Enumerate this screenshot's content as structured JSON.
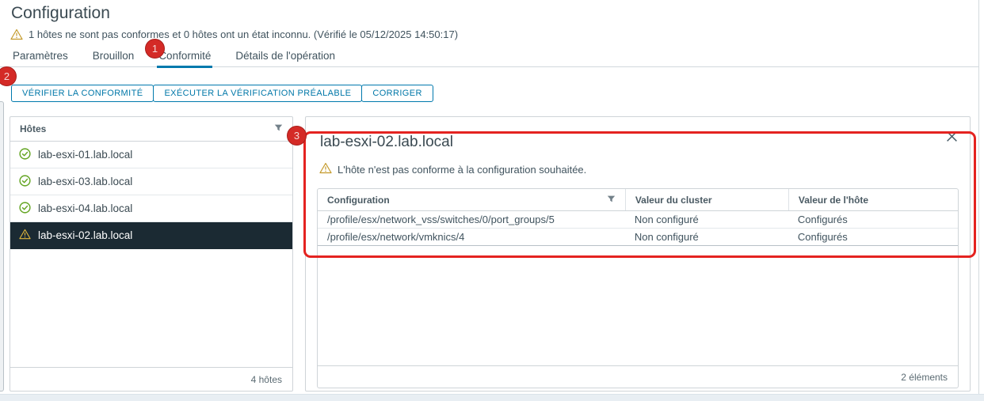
{
  "page": {
    "title": "Configuration",
    "status_message": "1 hôtes ne sont pas conformes et 0 hôtes ont un état inconnu. (Vérifié le 05/12/2025 14:50:17)"
  },
  "tabs": [
    {
      "label": "Paramètres",
      "active": false
    },
    {
      "label": "Brouillon",
      "active": false
    },
    {
      "label": "Conformité",
      "active": true
    },
    {
      "label": "Détails de l'opération",
      "active": false
    }
  ],
  "toolbar": {
    "buttons": [
      "VÉRIFIER LA CONFORMITÉ",
      "EXÉCUTER LA VÉRIFICATION PRÉALABLE",
      "CORRIGER"
    ]
  },
  "hosts_panel": {
    "header": "Hôtes",
    "items": [
      {
        "name": "lab-esxi-01.lab.local",
        "status": "compliant",
        "selected": false
      },
      {
        "name": "lab-esxi-03.lab.local",
        "status": "compliant",
        "selected": false
      },
      {
        "name": "lab-esxi-04.lab.local",
        "status": "compliant",
        "selected": false
      },
      {
        "name": "lab-esxi-02.lab.local",
        "status": "warning",
        "selected": true
      }
    ],
    "footer": "4 hôtes"
  },
  "detail_panel": {
    "title": "lab-esxi-02.lab.local",
    "warning_message": "L'hôte n'est pas conforme à la configuration souhaitée.",
    "table": {
      "columns": [
        "Configuration",
        "Valeur du cluster",
        "Valeur de l'hôte"
      ],
      "rows": [
        [
          "/profile/esx/network_vss/switches/0/port_groups/5",
          "Non configuré",
          "Configurés"
        ],
        [
          "/profile/esx/network/vmknics/4",
          "Non configuré",
          "Configurés"
        ]
      ],
      "footer": "2 éléments"
    }
  },
  "annotations": {
    "badges": [
      "1",
      "2",
      "3"
    ]
  },
  "icons": {
    "warning": "warning-triangle-icon",
    "compliant": "check-circle-icon",
    "filter": "filter-funnel-icon",
    "close": "close-icon"
  },
  "colors": {
    "accent_blue": "#0079ad",
    "compliant_green": "#62a420",
    "warning_gold": "#c49a2a",
    "selected_row_bg": "#1b2a33",
    "annotation_red": "#d42a26",
    "text": "#40535e"
  }
}
